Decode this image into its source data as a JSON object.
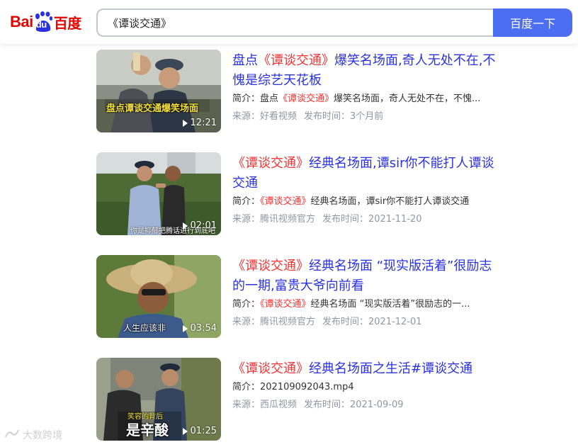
{
  "header": {
    "logo_bai": "Bai",
    "logo_du": "du",
    "logo_cn": "百度",
    "search_value": "《谭谈交通》",
    "search_button": "百度一下"
  },
  "results": [
    {
      "title_pre": "盘点",
      "title_hl": "《谭谈交通》",
      "title_post": "爆笑名场面,奇人无处不在,不愧是综艺天花板",
      "desc_label": "简介：",
      "desc_pre": "盘点",
      "desc_hl": "《谭谈交通》",
      "desc_post": "爆笑名场面，奇人无处不在，不愧...",
      "source": "来源：好看视频",
      "time": "发布时间：3个月前",
      "duration": "12:21",
      "thumb_caption": "盘点谭谈交通爆笑场面"
    },
    {
      "title_pre": "",
      "title_hl": "《谭谈交通》",
      "title_post": "经典名场面,谭sir你不能打人谭谈交通",
      "desc_label": "简介：",
      "desc_pre": "",
      "desc_hl": "《谭谈交通》",
      "desc_post": "经典名场面，谭sir你不能打人谭谈交通",
      "source": "来源：腾讯视频官方",
      "time": "发布时间：2021-11-20",
      "duration": "02:01",
      "thumb_caption": "你是抑郁把腾话进行到底吧"
    },
    {
      "title_pre": "",
      "title_hl": "《谭谈交通》",
      "title_post": "经典名场面 “现实版活着”很励志的一期,富贵大爷向前看",
      "desc_label": "简介：",
      "desc_pre": "",
      "desc_hl": "《谭谈交通》",
      "desc_post": "经典名场面 “现实版活着”很励志的一...",
      "source": "来源：腾讯视频官方",
      "time": "发布时间：2021-12-01",
      "duration": "03:54",
      "thumb_caption": "人生应该非"
    },
    {
      "title_pre": "",
      "title_hl": "《谭谈交通》",
      "title_post": "经典名场面之生活#谭谈交通",
      "desc_label": "简介：",
      "desc_pre": "",
      "desc_hl": "",
      "desc_post": "202109092043.mp4",
      "source": "来源：西瓜视频",
      "time": "发布时间：2021-09-09",
      "duration": "01:25",
      "thumb_caption": "是辛酸",
      "thumb_caption_small": "笑容的背后"
    }
  ],
  "watermark": "大数跨境",
  "colors": {
    "accent": "#4e6ef2",
    "link": "#2932e1",
    "highlight": "#f73131",
    "meta": "#9195a3"
  }
}
